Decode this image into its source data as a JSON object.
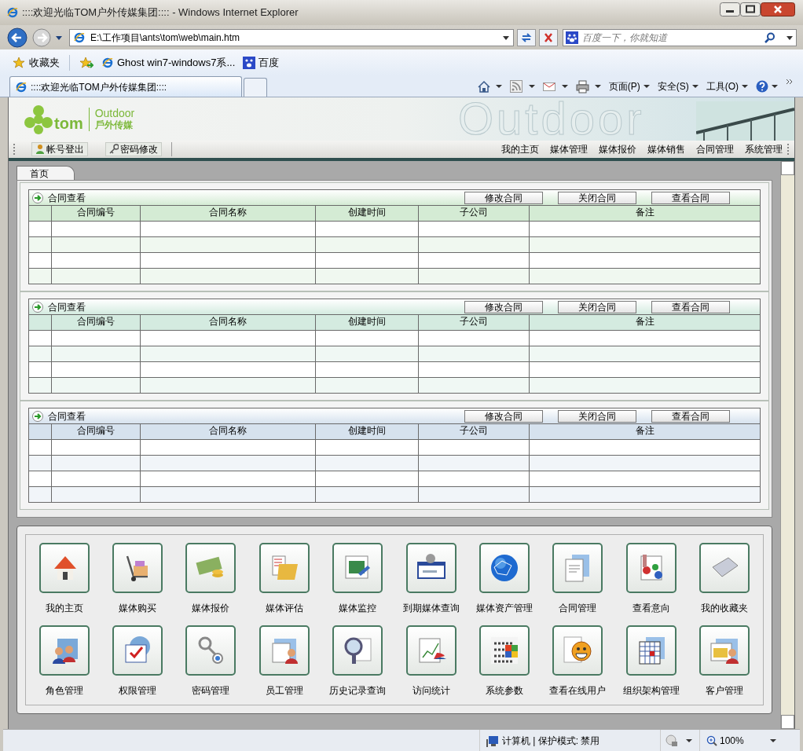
{
  "window": {
    "title": "::::欢迎光临TOM户外传媒集团:::: - Windows Internet Explorer"
  },
  "address_bar": {
    "value": "E:\\工作项目\\ants\\tom\\web\\main.htm"
  },
  "search": {
    "placeholder": "百度一下，你就知道"
  },
  "favorites_bar": {
    "label": "收藏夹",
    "items": [
      "Ghost win7-windows7系...",
      "百度"
    ]
  },
  "tabs": [
    {
      "label": "::::欢迎光临TOM户外传媒集团::::",
      "selected": true
    }
  ],
  "command_bar": {
    "menus": [
      "页面(P)",
      "安全(S)",
      "工具(O)"
    ]
  },
  "header": {
    "logo_brand": "tom",
    "logo_outdoor": "Outdoor",
    "logo_cn": "戶外传媒",
    "banner_text": "Outdoor",
    "toolbar_buttons": [
      "帐号登出",
      "密码修改"
    ],
    "nav": [
      "我的主页",
      "媒体管理",
      "媒体报价",
      "媒体销售",
      "合同管理",
      "系统管理"
    ]
  },
  "page_tabs": [
    {
      "label": "首页",
      "selected": true
    }
  ],
  "panels": [
    {
      "title": "合同查看",
      "color": "#d4ebd4",
      "buttons": [
        "修改合同",
        "关闭合同",
        "查看合同"
      ],
      "columns": [
        "合同编号",
        "合同名称",
        "创建时间",
        "子公司",
        "备注"
      ]
    },
    {
      "title": "合同查看",
      "color": "#d4ebe0",
      "buttons": [
        "修改合同",
        "关闭合同",
        "查看合同"
      ],
      "columns": [
        "合同编号",
        "合同名称",
        "创建时间",
        "子公司",
        "备注"
      ]
    },
    {
      "title": "合同查看",
      "color": "#d6e2ee",
      "buttons": [
        "修改合同",
        "关闭合同",
        "查看合同"
      ],
      "columns": [
        "合同编号",
        "合同名称",
        "创建时间",
        "子公司",
        "备注"
      ]
    }
  ],
  "modules": [
    "我的主页",
    "媒体购买",
    "媒体报价",
    "媒体评估",
    "媒体监控",
    "到期媒体查询",
    "媒体资产管理",
    "合同管理",
    "查看意向",
    "我的收藏夹",
    "角色管理",
    "权限管理",
    "密码管理",
    "员工管理",
    "历史记录查询",
    "访问统计",
    "系统参数",
    "查看在线用户",
    "组织架构管理",
    "客户管理"
  ],
  "status_bar": {
    "zone": "计算机 | 保护模式: 禁用",
    "zoom": "100%"
  }
}
